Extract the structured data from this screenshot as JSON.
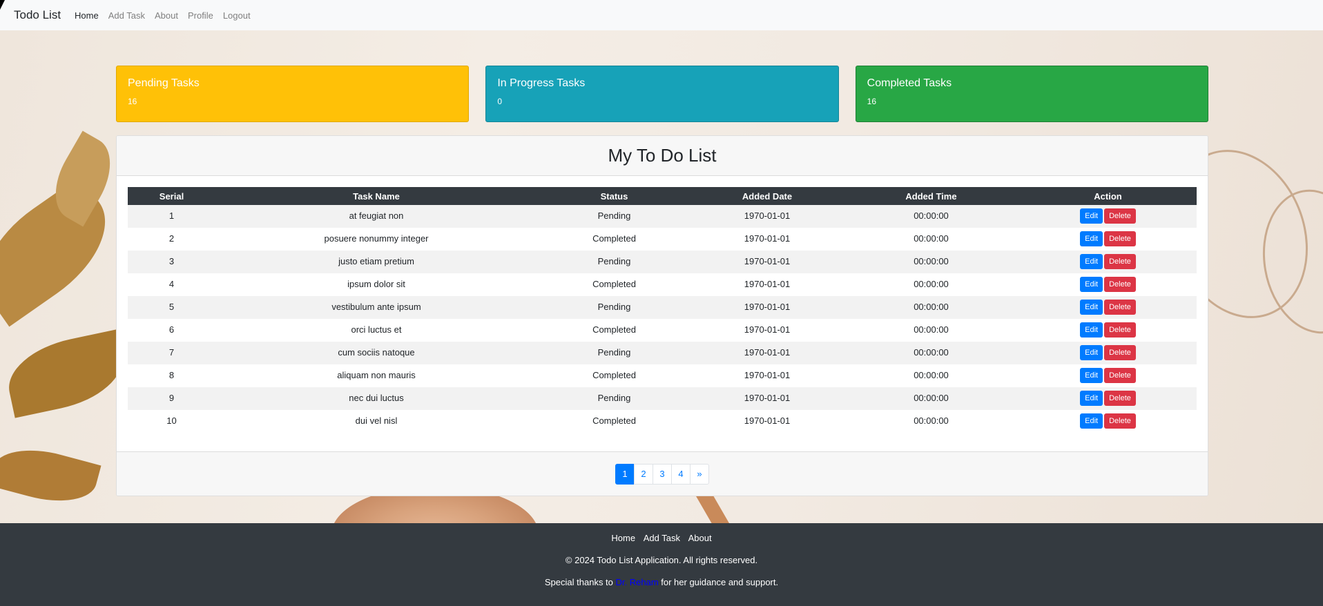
{
  "navbar": {
    "brand": "Todo List",
    "links": [
      "Home",
      "Add Task",
      "About",
      "Profile",
      "Logout"
    ]
  },
  "stats": {
    "pending": {
      "title": "Pending Tasks",
      "count": "16",
      "color": "#ffc107"
    },
    "in_progress": {
      "title": "In Progress Tasks",
      "count": "0",
      "color": "#17a2b8"
    },
    "completed": {
      "title": "Completed Tasks",
      "count": "16",
      "color": "#28a745"
    }
  },
  "main": {
    "title": "My To Do List",
    "columns": [
      "Serial",
      "Task Name",
      "Status",
      "Added Date",
      "Added Time",
      "Action"
    ],
    "rows": [
      {
        "serial": "1",
        "name": "at feugiat non",
        "status": "Pending",
        "date": "1970-01-01",
        "time": "00:00:00"
      },
      {
        "serial": "2",
        "name": "posuere nonummy integer",
        "status": "Completed",
        "date": "1970-01-01",
        "time": "00:00:00"
      },
      {
        "serial": "3",
        "name": "justo etiam pretium",
        "status": "Pending",
        "date": "1970-01-01",
        "time": "00:00:00"
      },
      {
        "serial": "4",
        "name": "ipsum dolor sit",
        "status": "Completed",
        "date": "1970-01-01",
        "time": "00:00:00"
      },
      {
        "serial": "5",
        "name": "vestibulum ante ipsum",
        "status": "Pending",
        "date": "1970-01-01",
        "time": "00:00:00"
      },
      {
        "serial": "6",
        "name": "orci luctus et",
        "status": "Completed",
        "date": "1970-01-01",
        "time": "00:00:00"
      },
      {
        "serial": "7",
        "name": "cum sociis natoque",
        "status": "Pending",
        "date": "1970-01-01",
        "time": "00:00:00"
      },
      {
        "serial": "8",
        "name": "aliquam non mauris",
        "status": "Completed",
        "date": "1970-01-01",
        "time": "00:00:00"
      },
      {
        "serial": "9",
        "name": "nec dui luctus",
        "status": "Pending",
        "date": "1970-01-01",
        "time": "00:00:00"
      },
      {
        "serial": "10",
        "name": "dui vel nisl",
        "status": "Completed",
        "date": "1970-01-01",
        "time": "00:00:00"
      }
    ],
    "edit_label": "Edit",
    "delete_label": "Delete",
    "pagination": [
      "1",
      "2",
      "3",
      "4",
      "»"
    ],
    "active_page": "1"
  },
  "footer": {
    "links": [
      "Home",
      "Add Task",
      "About"
    ],
    "copyright": "© 2024 Todo List Application. All rights reserved.",
    "thanks_prefix": "Special thanks to ",
    "thanks_name": "Dr. Reham",
    "thanks_suffix": " for her guidance and support."
  }
}
